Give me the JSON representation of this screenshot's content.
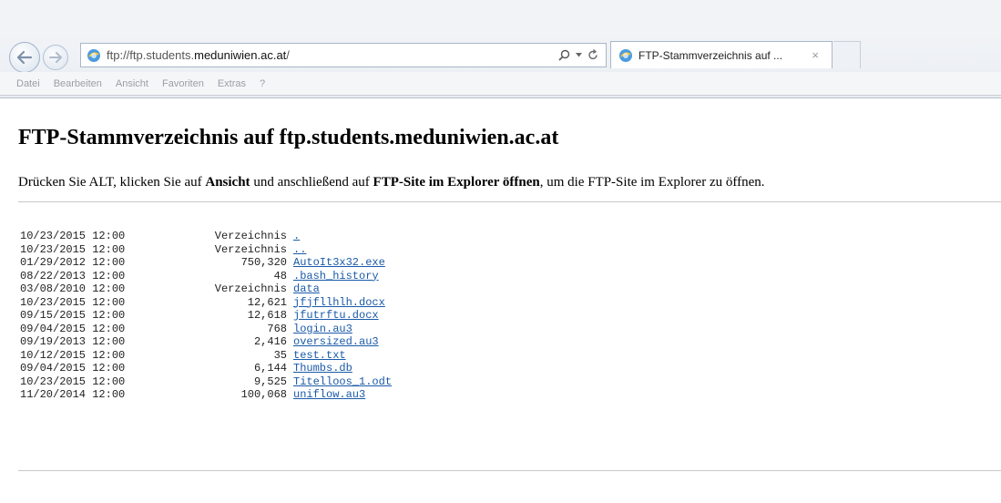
{
  "browser": {
    "address": {
      "prefix": "ftp://ftp.students.",
      "domain": "meduniwien.ac.at",
      "suffix": "/"
    },
    "search_icon": "search-icon",
    "dropdown_icon": "dropdown-arrow-icon",
    "refresh_icon": "refresh-icon",
    "tab": {
      "title": "FTP-Stammverzeichnis auf ...",
      "close": "×"
    },
    "menu": [
      "Datei",
      "Bearbeiten",
      "Ansicht",
      "Favoriten",
      "Extras",
      "?"
    ]
  },
  "page": {
    "title": "FTP-Stammverzeichnis auf ftp.students.meduniwien.ac.at",
    "instruction": {
      "part1": "Drücken Sie ALT, klicken Sie auf ",
      "bold1": "Ansicht",
      "part2": " und anschließend auf ",
      "bold2": "FTP-Site im Explorer öffnen",
      "part3": ", um die FTP-Site im Explorer zu öffnen."
    }
  },
  "listing": [
    {
      "date": "10/23/2015 12:00",
      "size": "Verzeichnis",
      "name": "."
    },
    {
      "date": "10/23/2015 12:00",
      "size": "Verzeichnis",
      "name": ".."
    },
    {
      "date": "01/29/2012 12:00",
      "size": "750,320",
      "name": "AutoIt3x32.exe"
    },
    {
      "date": "08/22/2013 12:00",
      "size": "48",
      "name": ".bash_history"
    },
    {
      "date": "03/08/2010 12:00",
      "size": "Verzeichnis",
      "name": "data"
    },
    {
      "date": "10/23/2015 12:00",
      "size": "12,621",
      "name": "jfjfllhlh.docx"
    },
    {
      "date": "09/15/2015 12:00",
      "size": "12,618",
      "name": "jfutrftu.docx"
    },
    {
      "date": "09/04/2015 12:00",
      "size": "768",
      "name": "login.au3"
    },
    {
      "date": "09/19/2013 12:00",
      "size": "2,416",
      "name": "oversized.au3"
    },
    {
      "date": "10/12/2015 12:00",
      "size": "35",
      "name": "test.txt"
    },
    {
      "date": "09/04/2015 12:00",
      "size": "6,144",
      "name": "Thumbs.db"
    },
    {
      "date": "10/23/2015 12:00",
      "size": "9,525",
      "name": "Titelloos_1.odt"
    },
    {
      "date": "11/20/2014 12:00",
      "size": "100,068",
      "name": "uniflow.au3"
    }
  ]
}
